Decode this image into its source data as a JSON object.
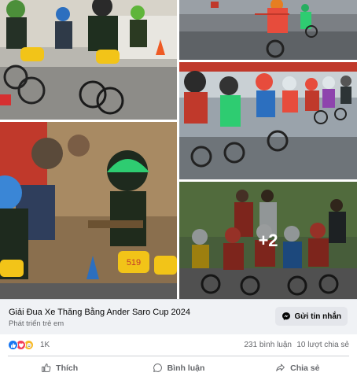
{
  "photos": {
    "more_count": "+2"
  },
  "link_preview": {
    "title": "Giải Đua Xe Thăng Bằng Ander Saro Cup 2024",
    "subtitle": "Phát triển trẻ em",
    "message_button": "Gửi tin nhắn"
  },
  "stats": {
    "reaction_count": "1K",
    "comments": "231 bình luận",
    "shares": "10 lượt chia sẻ"
  },
  "actions": {
    "like": "Thích",
    "comment": "Bình luận",
    "share": "Chia sẻ"
  },
  "colors": {
    "accent": "#1877f2",
    "love": "#f33e58",
    "care": "#f7b928",
    "muted_text": "#65676b",
    "preview_bg": "#f0f2f5"
  }
}
